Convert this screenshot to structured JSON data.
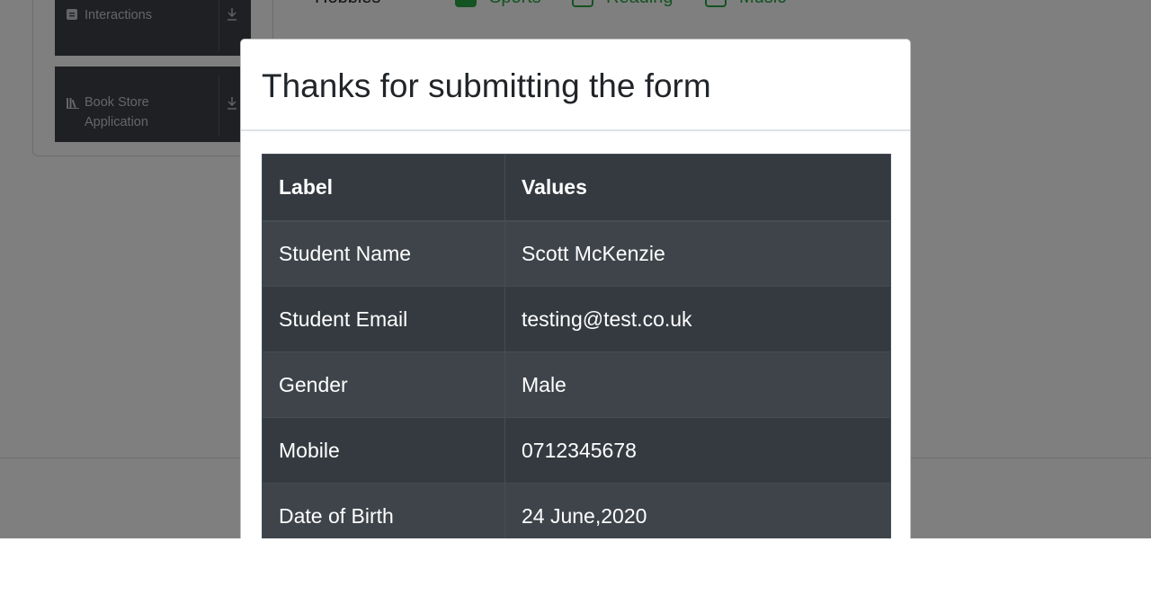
{
  "background_page": {
    "sidebar": {
      "groups": [
        {
          "label": "Interactions",
          "icon": "list-icon",
          "action_icon": "download-icon"
        },
        {
          "label_line1": "Book Store",
          "label_line2": "Application",
          "icon": "books-icon",
          "action_icon": "download-icon"
        }
      ]
    },
    "hobbies": {
      "label": "Hobbies",
      "options": [
        {
          "label": "Sports",
          "checked": true
        },
        {
          "label": "Reading",
          "checked": false
        },
        {
          "label": "Music",
          "checked": false
        }
      ]
    }
  },
  "modal": {
    "title": "Thanks for submitting the form",
    "table": {
      "headers": [
        "Label",
        "Values"
      ],
      "rows": [
        {
          "label": "Student Name",
          "value": "Scott McKenzie"
        },
        {
          "label": "Student Email",
          "value": "testing@test.co.uk"
        },
        {
          "label": "Gender",
          "value": "Male"
        },
        {
          "label": "Mobile",
          "value": "0712345678"
        },
        {
          "label": "Date of Birth",
          "value": "24 June,2020"
        }
      ]
    }
  },
  "colors": {
    "table_header": "#343a40",
    "table_row_alt": "#3e444a",
    "hobby_accent": "#28a745",
    "overlay": "rgba(0,0,0,0.5)"
  }
}
